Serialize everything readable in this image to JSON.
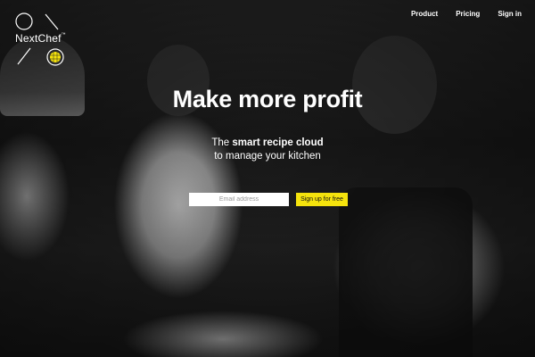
{
  "brand": {
    "name": "NextChef",
    "trademark": "™"
  },
  "nav": {
    "items": [
      "Product",
      "Pricing",
      "Sign in"
    ]
  },
  "hero": {
    "headline": "Make more profit",
    "tagline_bold": "smart recipe cloud",
    "tagline_pre": "The ",
    "tagline_line2": "to manage your kitchen"
  },
  "signup": {
    "email_placeholder": "Email address",
    "button_label": "Sign up for free"
  },
  "colors": {
    "accent": "#f5e30d",
    "text": "#ffffff"
  }
}
